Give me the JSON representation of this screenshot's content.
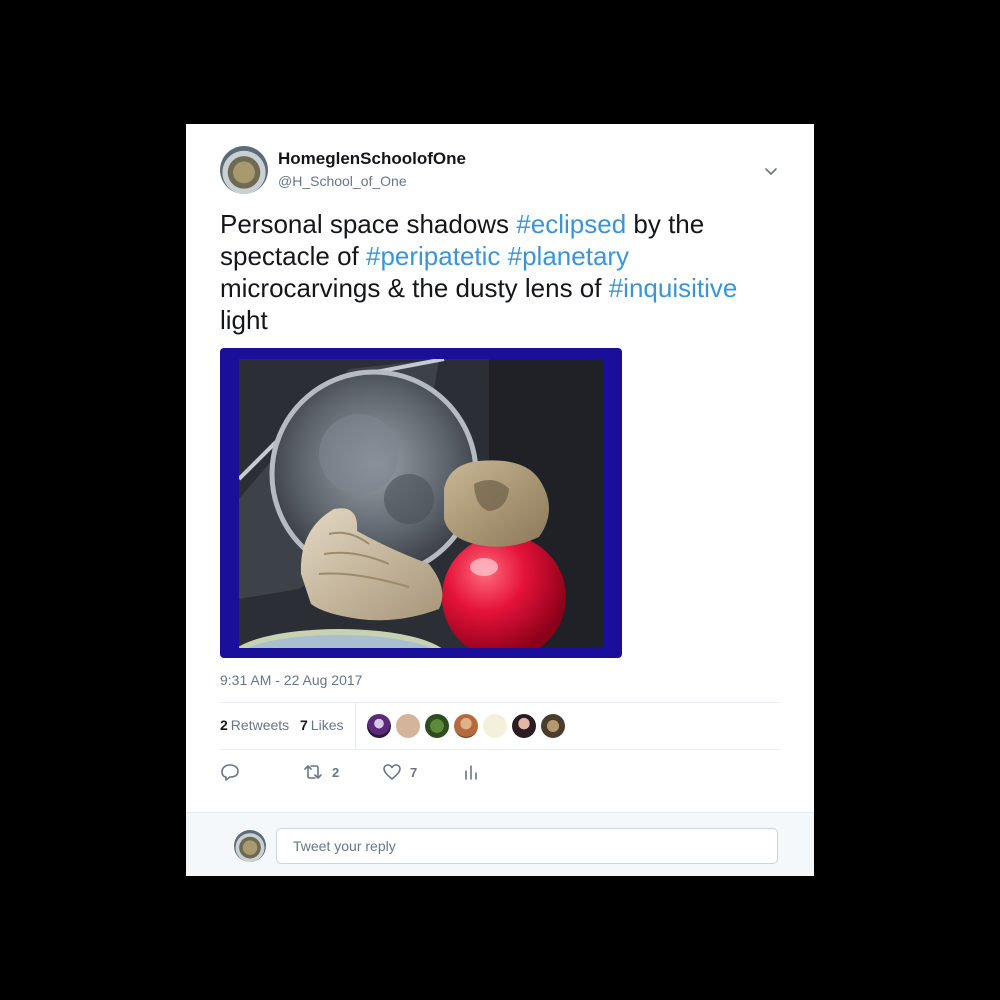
{
  "tweet": {
    "author": {
      "display_name": "HomeglenSchoolofOne",
      "handle": "@H_School_of_One"
    },
    "text": {
      "p1": "Personal space shadows ",
      "h1": "#eclipsed",
      "p2": " by the spectacle of ",
      "h2": "#peripatetic",
      "p3": " ",
      "h3": "#planetary",
      "p4": " microcarvings & the dusty lens of ",
      "h4": "#inquisitive",
      "p5": " light"
    },
    "timestamp": "9:31 AM - 22 Aug 2017",
    "stats": {
      "retweets_count": "2",
      "retweets_label": "Retweets",
      "likes_count": "7",
      "likes_label": "Likes"
    },
    "actions": {
      "reply_icon": "reply-icon",
      "retweet_icon": "retweet-icon",
      "retweet_count": "2",
      "like_icon": "heart-icon",
      "like_count": "7",
      "analytics_icon": "analytics-icon"
    },
    "likers_count": 7
  },
  "reply": {
    "placeholder": "Tweet your reply"
  },
  "colors": {
    "hashtag": "#3b94d9",
    "text": "#14171a",
    "secondary": "#657786",
    "media_frame": "#1a0f9c",
    "page_background": "#000000"
  }
}
